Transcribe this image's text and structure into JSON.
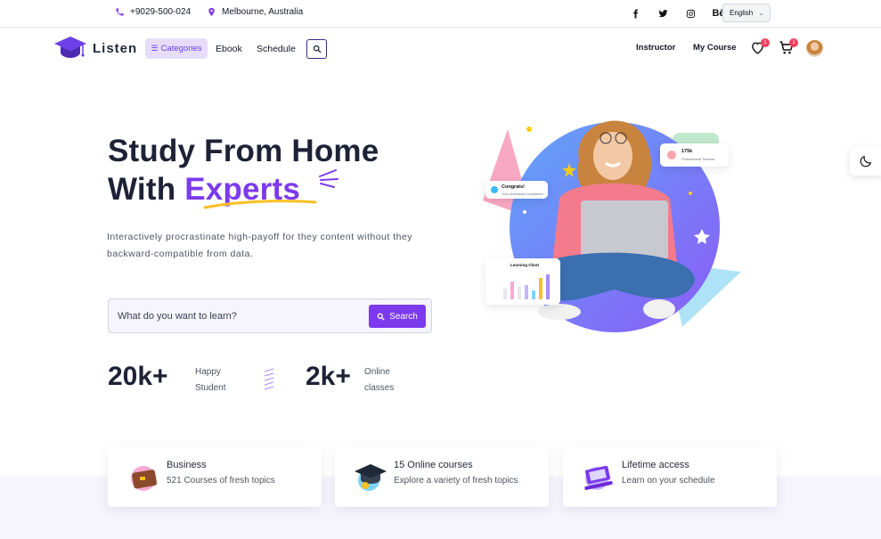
{
  "topbar": {
    "phone": "+9029-500-024",
    "location": "Melbourne, Australia",
    "socials": [
      "facebook-icon",
      "twitter-icon",
      "instagram-icon",
      "behance-icon"
    ],
    "behance_label": "Bē",
    "language": "English"
  },
  "nav": {
    "brand": "Listen",
    "categories_label": "Categories",
    "links": [
      "Ebook",
      "Schedule"
    ],
    "right_links": [
      "Instructor",
      "My Course"
    ],
    "wishlist_count": "1",
    "cart_count": "1"
  },
  "hero": {
    "title_line1": "Study From Home",
    "title_line2_prefix": "With ",
    "title_accent": "Experts",
    "description": "Interactively procrastinate high-payoff for they content without they backward-compatible from data.",
    "search_placeholder": "What do you want to learn?",
    "search_button": "Search",
    "stats": [
      {
        "value": "20k+",
        "label": "Happy Student"
      },
      {
        "value": "2k+",
        "label": "Online classes"
      }
    ],
    "float_cards": {
      "congrats_title": "Congrats!",
      "congrats_sub": "Your admission completed",
      "teacher_count": "175k",
      "teacher_label": "Professional Teacher",
      "chart_title": "Learning Chart"
    }
  },
  "features": [
    {
      "title": "Business",
      "subtitle": "521 Courses of fresh topics"
    },
    {
      "title": "15 Online courses",
      "subtitle": "Explore a variety of fresh topics"
    },
    {
      "title": "Lifetime access",
      "subtitle": "Learn on your schedule"
    }
  ],
  "colors": {
    "accent": "#7c3aed",
    "dark_text": "#1e2236",
    "badge": "#f43f5e",
    "band": "#f6f4fc"
  }
}
